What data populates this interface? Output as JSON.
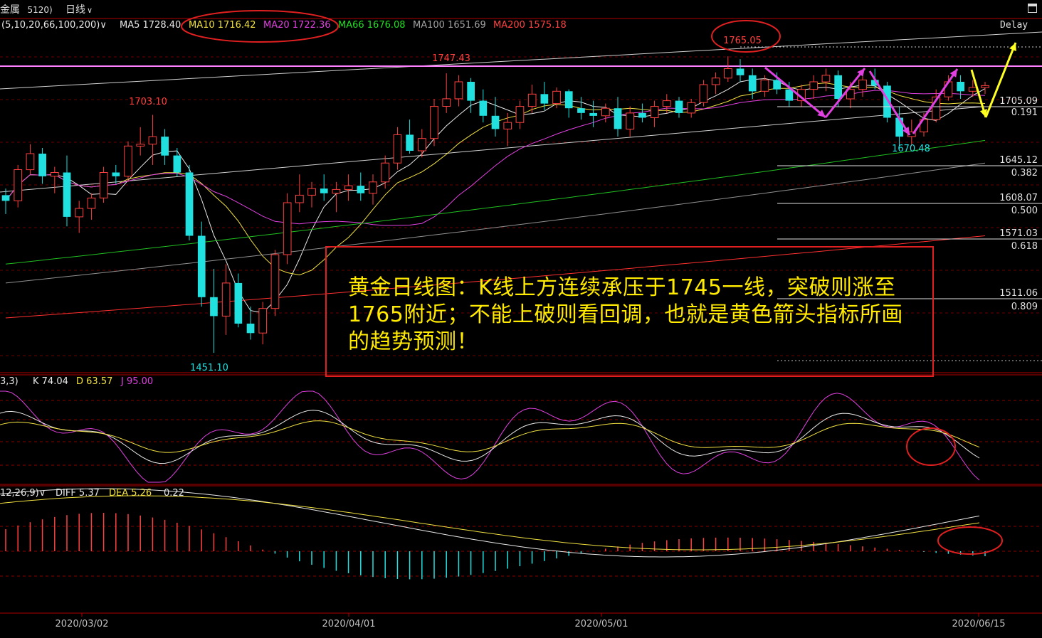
{
  "header": {
    "symbol_label": "金属",
    "symbol_code": "5120)",
    "period_select": "日线",
    "period_arrow": "∨"
  },
  "ma_legend": {
    "params": "(5,10,20,66,100,200)",
    "params_arrow": "∨",
    "items": [
      {
        "label": "MA5 1728.40",
        "color": "#e8e8e8"
      },
      {
        "label": "MA10 1716.42",
        "color": "#f0e040"
      },
      {
        "label": "MA20 1722.36",
        "color": "#e040e0"
      },
      {
        "label": "MA66 1676.08",
        "color": "#20e020"
      },
      {
        "label": "MA100 1651.69",
        "color": "#a0a0a0"
      },
      {
        "label": "MA200 1575.18",
        "color": "#ff4040"
      }
    ],
    "delay_label": "Delay"
  },
  "price_labels": {
    "high_1765": "1765.05",
    "high_1747": "1747.43",
    "high_1703": "1703.10",
    "low_1670": "1670.48",
    "low_1451": "1451.10"
  },
  "fib_levels": [
    {
      "price": "1705.09",
      "ratio": "0.191"
    },
    {
      "price": "1645.12",
      "ratio": "0.382"
    },
    {
      "price": "1608.07",
      "ratio": "0.500"
    },
    {
      "price": "1571.03",
      "ratio": "0.618"
    },
    {
      "price": "1511.06",
      "ratio": "0.809"
    }
  ],
  "kdj_legend": {
    "params": "3,3)",
    "params_arrow": "∨",
    "k": "K 74.04",
    "d": "D 63.57",
    "j": "J 95.00"
  },
  "macd_legend": {
    "params": "12,26,9)",
    "params_arrow": "∨",
    "diff": "DIFF 5.37",
    "dea": "DEA 5.26",
    "macd": "0.22"
  },
  "x_axis": [
    "2020/03/02",
    "2020/04/01",
    "2020/05/01",
    "2020/06/15"
  ],
  "annotation": {
    "text": "黄金日线图：K线上方连续承压于1745一线，突破则涨至1765附近；不能上破则看回调，也就是黄色箭头指标所画的趋势预测！"
  },
  "colors": {
    "bull": "#ff4040",
    "bear": "#20e0e0",
    "grid": "#a00000",
    "ma5": "#e8e8e8",
    "ma10": "#f0e040",
    "ma20": "#e040e0",
    "ma66": "#20c020",
    "ma100": "#909090",
    "ma200": "#ff3030",
    "resistance_line": "#ff80ff",
    "magenta_arrows": "#e040e0",
    "yellow_arrow": "#ffff20",
    "annotation_box": "#e02020"
  },
  "chart_data": [
    {
      "type": "candlestick",
      "title": "",
      "x_start": "2020/02/20",
      "x_end": "2020/06/15",
      "dates": [
        "02/20",
        "02/21",
        "02/24",
        "02/25",
        "02/26",
        "02/27",
        "02/28",
        "03/02",
        "03/03",
        "03/04",
        "03/05",
        "03/06",
        "03/09",
        "03/10",
        "03/11",
        "03/12",
        "03/13",
        "03/16",
        "03/17",
        "03/18",
        "03/19",
        "03/20",
        "03/23",
        "03/24",
        "03/25",
        "03/26",
        "03/27",
        "03/30",
        "03/31",
        "04/01",
        "04/02",
        "04/03",
        "04/06",
        "04/07",
        "04/08",
        "04/09",
        "04/13",
        "04/14",
        "04/15",
        "04/16",
        "04/17",
        "04/20",
        "04/21",
        "04/22",
        "04/23",
        "04/24",
        "04/27",
        "04/28",
        "04/29",
        "04/30",
        "05/01",
        "05/04",
        "05/05",
        "05/06",
        "05/07",
        "05/08",
        "05/11",
        "05/12",
        "05/13",
        "05/14",
        "05/15",
        "05/18",
        "05/19",
        "05/20",
        "05/21",
        "05/22",
        "05/26",
        "05/27",
        "05/28",
        "05/29",
        "06/01",
        "06/02",
        "06/03",
        "06/04",
        "06/05",
        "06/08",
        "06/09",
        "06/10",
        "06/11",
        "06/12",
        "06/15"
      ],
      "ohlc": [
        [
          1618,
          1625,
          1598,
          1612
        ],
        [
          1612,
          1650,
          1605,
          1645
        ],
        [
          1645,
          1672,
          1640,
          1662
        ],
        [
          1662,
          1668,
          1630,
          1638
        ],
        [
          1638,
          1648,
          1620,
          1642
        ],
        [
          1642,
          1660,
          1585,
          1595
        ],
        [
          1595,
          1612,
          1578,
          1604
        ],
        [
          1604,
          1620,
          1592,
          1615
        ],
        [
          1615,
          1648,
          1610,
          1642
        ],
        [
          1642,
          1650,
          1630,
          1638
        ],
        [
          1638,
          1675,
          1632,
          1670
        ],
        [
          1670,
          1690,
          1660,
          1672
        ],
        [
          1672,
          1703,
          1650,
          1680
        ],
        [
          1680,
          1688,
          1650,
          1660
        ],
        [
          1660,
          1668,
          1638,
          1642
        ],
        [
          1642,
          1650,
          1570,
          1575
        ],
        [
          1575,
          1590,
          1500,
          1510
        ],
        [
          1510,
          1540,
          1451,
          1490
        ],
        [
          1490,
          1545,
          1470,
          1525
        ],
        [
          1525,
          1535,
          1478,
          1482
        ],
        [
          1482,
          1500,
          1465,
          1472
        ],
        [
          1472,
          1505,
          1460,
          1498
        ],
        [
          1498,
          1560,
          1490,
          1555
        ],
        [
          1555,
          1620,
          1545,
          1610
        ],
        [
          1610,
          1640,
          1600,
          1618
        ],
        [
          1618,
          1632,
          1605,
          1625
        ],
        [
          1625,
          1640,
          1612,
          1620
        ],
        [
          1620,
          1632,
          1600,
          1624
        ],
        [
          1624,
          1640,
          1612,
          1628
        ],
        [
          1628,
          1642,
          1612,
          1620
        ],
        [
          1620,
          1640,
          1608,
          1632
        ],
        [
          1632,
          1660,
          1625,
          1652
        ],
        [
          1652,
          1690,
          1645,
          1682
        ],
        [
          1682,
          1698,
          1662,
          1665
        ],
        [
          1665,
          1688,
          1658,
          1678
        ],
        [
          1678,
          1720,
          1670,
          1712
        ],
        [
          1712,
          1747,
          1705,
          1720
        ],
        [
          1720,
          1745,
          1712,
          1738
        ],
        [
          1738,
          1742,
          1705,
          1718
        ],
        [
          1718,
          1730,
          1695,
          1702
        ],
        [
          1702,
          1722,
          1680,
          1688
        ],
        [
          1688,
          1705,
          1670,
          1695
        ],
        [
          1695,
          1718,
          1688,
          1712
        ],
        [
          1712,
          1735,
          1705,
          1725
        ],
        [
          1725,
          1738,
          1708,
          1715
        ],
        [
          1715,
          1732,
          1710,
          1728
        ],
        [
          1728,
          1730,
          1700,
          1710
        ],
        [
          1710,
          1722,
          1698,
          1705
        ],
        [
          1705,
          1718,
          1690,
          1702
        ],
        [
          1702,
          1715,
          1695,
          1710
        ],
        [
          1710,
          1722,
          1680,
          1688
        ],
        [
          1688,
          1712,
          1680,
          1705
        ],
        [
          1705,
          1715,
          1695,
          1700
        ],
        [
          1700,
          1718,
          1690,
          1712
        ],
        [
          1712,
          1725,
          1705,
          1718
        ],
        [
          1718,
          1722,
          1700,
          1705
        ],
        [
          1705,
          1720,
          1700,
          1716
        ],
        [
          1716,
          1740,
          1712,
          1735
        ],
        [
          1735,
          1748,
          1725,
          1742
        ],
        [
          1742,
          1765,
          1738,
          1752
        ],
        [
          1752,
          1762,
          1738,
          1745
        ],
        [
          1745,
          1752,
          1720,
          1728
        ],
        [
          1728,
          1745,
          1722,
          1740
        ],
        [
          1740,
          1748,
          1725,
          1730
        ],
        [
          1730,
          1738,
          1712,
          1718
        ],
        [
          1718,
          1735,
          1712,
          1730
        ],
        [
          1730,
          1745,
          1720,
          1738
        ],
        [
          1738,
          1752,
          1728,
          1745
        ],
        [
          1745,
          1750,
          1712,
          1720
        ],
        [
          1720,
          1738,
          1710,
          1730
        ],
        [
          1730,
          1745,
          1722,
          1740
        ],
        [
          1740,
          1752,
          1730,
          1734
        ],
        [
          1734,
          1738,
          1695,
          1700
        ],
        [
          1700,
          1712,
          1670,
          1680
        ],
        [
          1680,
          1698,
          1670,
          1685
        ],
        [
          1685,
          1705,
          1680,
          1698
        ],
        [
          1698,
          1730,
          1695,
          1722
        ],
        [
          1722,
          1745,
          1718,
          1738
        ],
        [
          1738,
          1745,
          1720,
          1728
        ],
        [
          1728,
          1740,
          1722,
          1732
        ],
        [
          1732,
          1738,
          1725,
          1734
        ]
      ],
      "ylim": [
        1430,
        1790
      ]
    },
    {
      "type": "line",
      "title": "KDJ",
      "series": [
        {
          "name": "K",
          "last": 74.04
        },
        {
          "name": "D",
          "last": 63.57
        },
        {
          "name": "J",
          "last": 95.0
        }
      ]
    },
    {
      "type": "bar",
      "title": "MACD",
      "series": [
        {
          "name": "DIFF",
          "last": 5.37
        },
        {
          "name": "DEA",
          "last": 5.26
        }
      ],
      "histogram_last": 0.22
    }
  ]
}
